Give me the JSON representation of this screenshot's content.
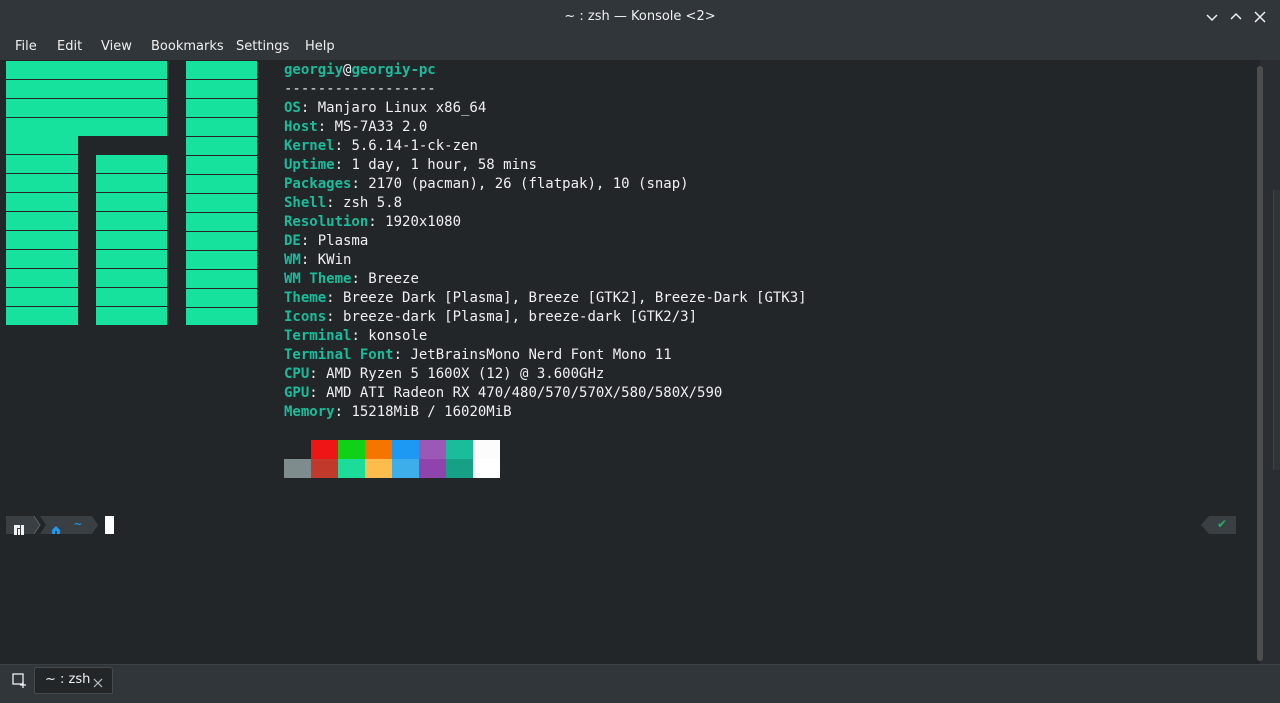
{
  "window": {
    "title": "~ : zsh — Konsole <2>",
    "controls": [
      "minimize-icon",
      "maximize-icon",
      "close-icon"
    ]
  },
  "menubar": {
    "items": [
      {
        "label": "File"
      },
      {
        "label": "Edit"
      },
      {
        "label": "View"
      },
      {
        "label": "Bookmarks"
      },
      {
        "label": "Settings"
      },
      {
        "label": "Help"
      }
    ]
  },
  "neofetch": {
    "user": "georgiy",
    "at": "@",
    "host": "georgiy-pc",
    "separator": "------------------",
    "fields": [
      {
        "key": "OS",
        "value": "Manjaro Linux x86_64"
      },
      {
        "key": "Host",
        "value": "MS-7A33 2.0"
      },
      {
        "key": "Kernel",
        "value": "5.6.14-1-ck-zen"
      },
      {
        "key": "Uptime",
        "value": "1 day, 1 hour, 58 mins"
      },
      {
        "key": "Packages",
        "value": "2170 (pacman), 26 (flatpak), 10 (snap)"
      },
      {
        "key": "Shell",
        "value": "zsh 5.8"
      },
      {
        "key": "Resolution",
        "value": "1920x1080"
      },
      {
        "key": "DE",
        "value": "Plasma"
      },
      {
        "key": "WM",
        "value": "KWin"
      },
      {
        "key": "WM Theme",
        "value": "Breeze"
      },
      {
        "key": "Theme",
        "value": "Breeze Dark [Plasma], Breeze [GTK2], Breeze-Dark [GTK3]"
      },
      {
        "key": "Icons",
        "value": "breeze-dark [Plasma], breeze-dark [GTK2/3]"
      },
      {
        "key": "Terminal",
        "value": "konsole"
      },
      {
        "key": "Terminal Font",
        "value": "JetBrainsMono Nerd Font Mono 11"
      },
      {
        "key": "CPU",
        "value": "AMD Ryzen 5 1600X (12) @ 3.600GHz"
      },
      {
        "key": "GPU",
        "value": "AMD ATI Radeon RX 470/480/570/570X/580/580X/590"
      },
      {
        "key": "Memory",
        "value": "15218MiB / 16020MiB"
      }
    ],
    "palette_top": [
      "#232629",
      "#ed1515",
      "#11d116",
      "#f67400",
      "#1d99f3",
      "#9b59b6",
      "#1abc9c",
      "#fcfcfc"
    ],
    "palette_bottom": [
      "#7f8c8d",
      "#c0392b",
      "#1cdc9a",
      "#fdbc4b",
      "#3daee9",
      "#8e44ad",
      "#16a085",
      "#ffffff"
    ],
    "colors": {
      "accent": "#1abc9c",
      "logo": "#16e29d"
    }
  },
  "prompt": {
    "os_icon": "manjaro-icon",
    "home_icon": "home-icon",
    "dir": "~",
    "status_icon": "checkmark-icon",
    "status": "✔"
  },
  "tabs": {
    "new_tab_icon": "new-tab-icon",
    "items": [
      {
        "label": "~ : zsh",
        "close_icon": "close-icon"
      }
    ]
  }
}
